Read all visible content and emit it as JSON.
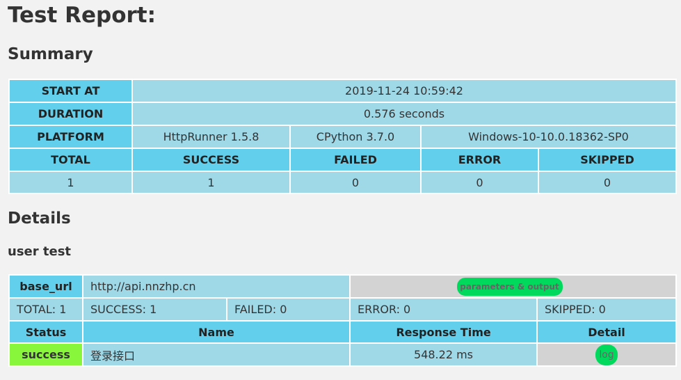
{
  "title": "Test Report:",
  "summary_heading": "Summary",
  "summary": {
    "start_at_label": "START AT",
    "start_at_value": "2019-11-24 10:59:42",
    "duration_label": "DURATION",
    "duration_value": "0.576 seconds",
    "platform_label": "PLATFORM",
    "platform_values": [
      "HttpRunner 1.5.8",
      "CPython 3.7.0",
      "Windows-10-10.0.18362-SP0"
    ],
    "stat_headers": [
      "TOTAL",
      "SUCCESS",
      "FAILED",
      "ERROR",
      "SKIPPED"
    ],
    "stat_values": [
      "1",
      "1",
      "0",
      "0",
      "0"
    ]
  },
  "details_heading": "Details",
  "suite": {
    "name": "user test",
    "base_url_label": "base_url",
    "base_url_value": "http://api.nnzhp.cn",
    "params_button": "parameters & output",
    "total": "TOTAL: 1",
    "success": "SUCCESS: 1",
    "failed": "FAILED: 0",
    "error": "ERROR: 0",
    "skipped": "SKIPPED: 0",
    "columns": [
      "Status",
      "Name",
      "Response Time",
      "Detail"
    ],
    "rows": [
      {
        "status": "success",
        "name": "登录接口",
        "response_time": "548.22 ms",
        "detail": "log"
      }
    ]
  },
  "colors": {
    "header_blue": "#62d0ec",
    "cell_blue": "#9fd9e8",
    "gray": "#d3d3d3",
    "success_green": "#88f63a",
    "button_green": "#00d95c"
  }
}
